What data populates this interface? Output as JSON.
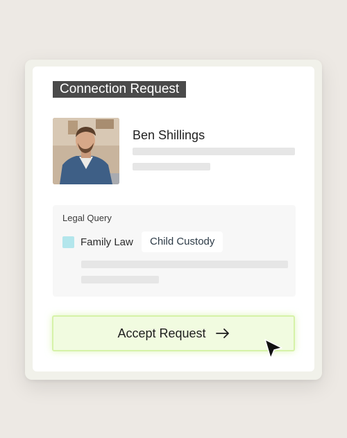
{
  "card": {
    "title": "Connection Request"
  },
  "profile": {
    "name": "Ben Shillings",
    "avatar_icon": "profile-photo"
  },
  "query": {
    "label": "Legal Query",
    "category": "Family Law",
    "tag": "Child Custody",
    "checkbox_color": "#b3e6ec"
  },
  "actions": {
    "accept_label": "Accept Request",
    "arrow_icon": "arrow-right-icon",
    "cursor_icon": "mouse-pointer-icon",
    "accent_color": "#f1fbe0"
  }
}
